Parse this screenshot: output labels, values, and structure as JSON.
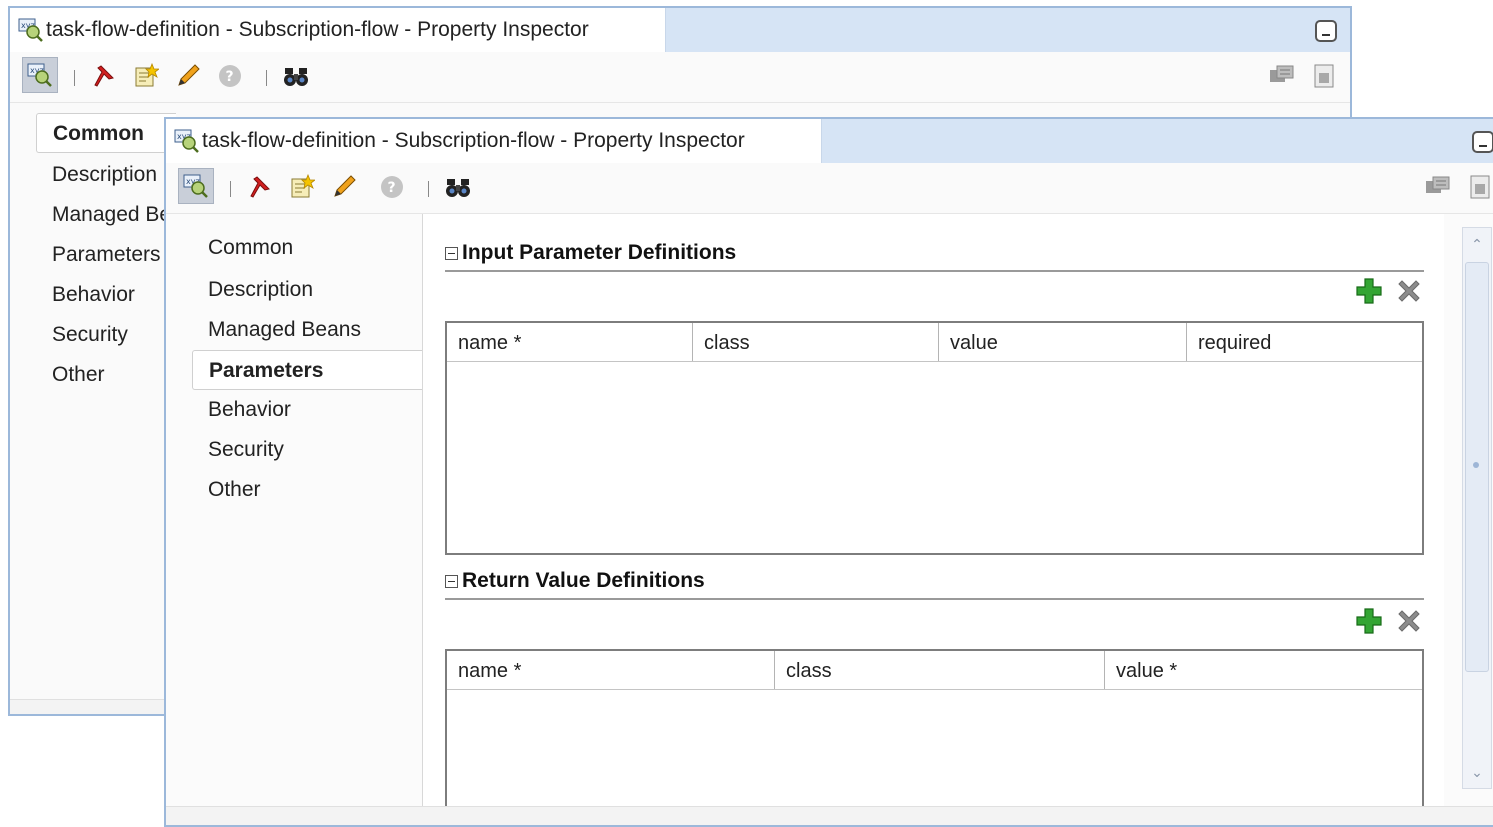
{
  "back_window": {
    "title": "task-flow-definition - Subscription-flow - Property Inspector",
    "nav": [
      "Common",
      "Description",
      "Managed Be",
      "Parameters",
      "Behavior",
      "Security",
      "Other"
    ]
  },
  "front_window": {
    "title": "task-flow-definition - Subscription-flow - Property Inspector",
    "nav": [
      "Common",
      "Description",
      "Managed Beans",
      "Parameters",
      "Behavior",
      "Security",
      "Other"
    ],
    "input_section": {
      "title": "Input Parameter Definitions",
      "columns": [
        "name *",
        "class",
        "value",
        "required"
      ],
      "rows": []
    },
    "return_section": {
      "title": "Return Value Definitions",
      "columns": [
        "name *",
        "class",
        "value *"
      ],
      "rows": []
    }
  },
  "toolbar_icons": [
    "inspector-icon",
    "pin-icon",
    "edit-note-icon",
    "pencil-icon",
    "help-icon",
    "binoculars-icon",
    "properties-icon",
    "document-icon"
  ],
  "colors": {
    "titlebar": "#d6e4f5",
    "border": "#9cb8da",
    "add": "#2e9c2e",
    "delete": "#8c8c8c",
    "pin": "#d21f1f"
  }
}
